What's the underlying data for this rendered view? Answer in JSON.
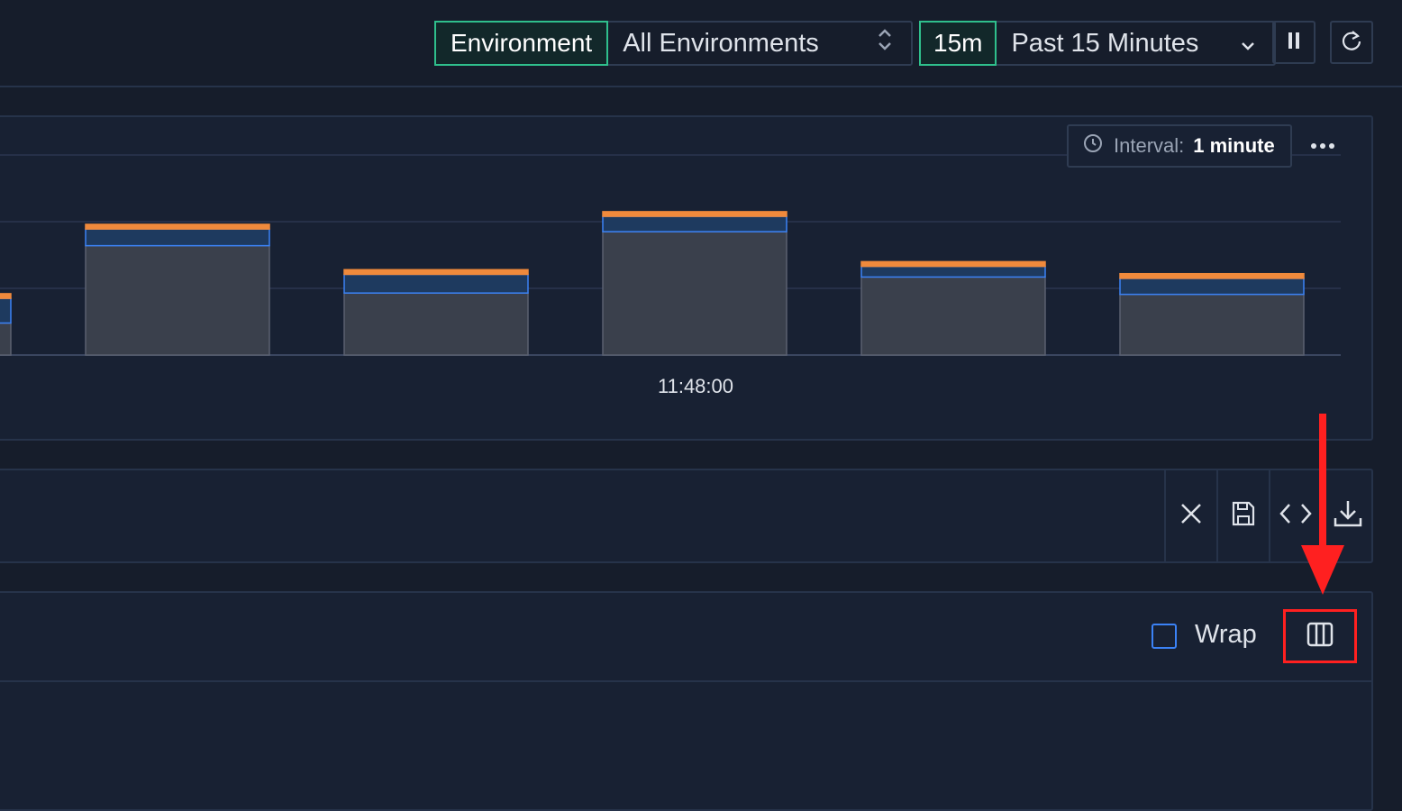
{
  "filters": {
    "environment_label": "Environment",
    "environment_value": "All Environments",
    "time_short": "15m",
    "time_value": "Past 15 Minutes"
  },
  "chart": {
    "interval_label": "Interval:",
    "interval_value": "1 minute",
    "x_tick": "11:48:00"
  },
  "chart_data": {
    "type": "bar",
    "stacked": true,
    "categories": [
      "",
      "",
      "",
      "",
      "",
      ""
    ],
    "series": [
      {
        "values": [
          0.48,
          1.64,
          0.93,
          1.85,
          1.17,
          0.91
        ]
      },
      {
        "values": [
          0.37,
          0.25,
          0.28,
          0.23,
          0.16,
          0.24
        ]
      },
      {
        "values": [
          0.07,
          0.07,
          0.07,
          0.07,
          0.07,
          0.07
        ]
      }
    ],
    "colors": [
      "#3a404c",
      "#1e3a5f",
      "#f08a3c"
    ],
    "ylim": [
      0,
      3
    ],
    "grid": true
  },
  "query_toolbar": {
    "close": "close-icon",
    "save": "save-icon",
    "code": "code-icon",
    "download": "download-icon"
  },
  "results": {
    "wrap_label": "Wrap",
    "columns_icon": "columns-icon"
  },
  "annotation_color": "#ff2020"
}
